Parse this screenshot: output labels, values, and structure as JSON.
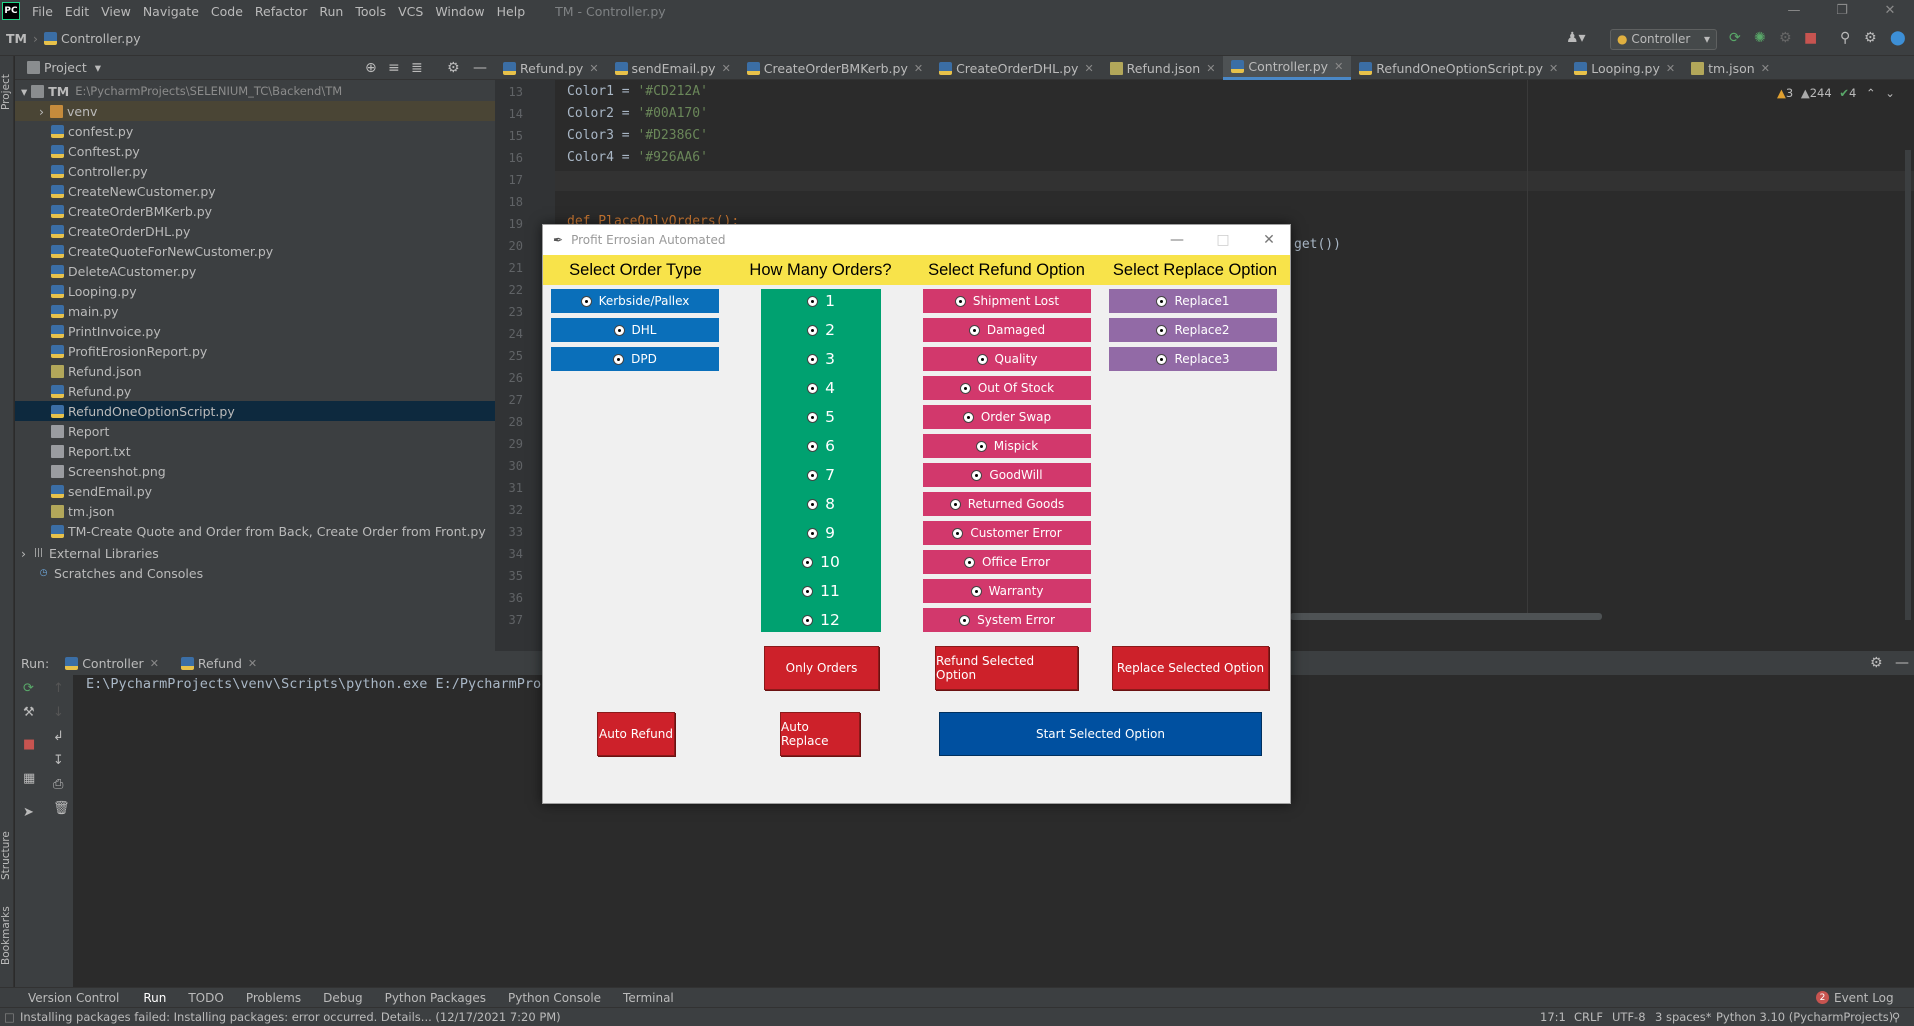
{
  "menubar": {
    "logo": "PC",
    "items": [
      "File",
      "Edit",
      "View",
      "Navigate",
      "Code",
      "Refactor",
      "Run",
      "Tools",
      "VCS",
      "Window",
      "Help"
    ],
    "window_title": "TM - Controller.py"
  },
  "navbar": {
    "project": "TM",
    "file": "Controller.py",
    "run_config": "Controller"
  },
  "sidebar": {
    "project_label": "Project",
    "structure_label": "Structure",
    "bookmarks_label": "Bookmarks"
  },
  "project_tree": {
    "header": "Project",
    "root_name": "TM",
    "root_path": "E:\\PycharmProjects\\SELENIUM_TC\\Backend\\TM",
    "venv": "venv",
    "files": [
      "confest.py",
      "Conftest.py",
      "Controller.py",
      "CreateNewCustomer.py",
      "CreateOrderBMKerb.py",
      "CreateOrderDHL.py",
      "CreateQuoteForNewCustomer.py",
      "DeleteACustomer.py",
      "Looping.py",
      "main.py",
      "PrintInvoice.py",
      "ProfitErosionReport.py",
      "Refund.json",
      "Refund.py",
      "RefundOneOptionScript.py",
      "Report",
      "Report.txt",
      "Screenshot.png",
      "sendEmail.py",
      "tm.json",
      "TM-Create Quote and Order from Back, Create Order from Front.py"
    ],
    "external_libraries": "External Libraries",
    "scratches": "Scratches and Consoles"
  },
  "editor_tabs": [
    "Refund.py",
    "sendEmail.py",
    "CreateOrderBMKerb.py",
    "CreateOrderDHL.py",
    "Refund.json",
    "Controller.py",
    "RefundOneOptionScript.py",
    "Looping.py",
    "tm.json"
  ],
  "inspections": {
    "warnings": "3",
    "weak": "244",
    "ok": "4"
  },
  "editor": {
    "line_numbers": [
      "13",
      "14",
      "15",
      "16",
      "17",
      "18",
      "19",
      "20",
      "21",
      "22",
      "23",
      "24",
      "25",
      "26",
      "27",
      "28",
      "29",
      "30",
      "31",
      "32",
      "33",
      "34",
      "35",
      "36",
      "37"
    ],
    "lines": [
      {
        "var": "Color1",
        "eq": " = ",
        "str": "'#CD212A'"
      },
      {
        "var": "Color2",
        "eq": " = ",
        "str": "'#00A170'"
      },
      {
        "var": "Color3",
        "eq": " = ",
        "str": "'#D2386C'"
      },
      {
        "var": "Color4",
        "eq": " = ",
        "str": "'#926AA6'"
      }
    ],
    "fragment_def": "def PlaceOnlyOrders():",
    "fragment_get": "get())"
  },
  "run_panel": {
    "label": "Run:",
    "tabs": [
      "Controller",
      "Refund"
    ],
    "console_line": "E:\\PycharmProjects\\venv\\Scripts\\python.exe E:/PycharmProj"
  },
  "bottom_tools": [
    "Version Control",
    "Run",
    "TODO",
    "Problems",
    "Debug",
    "Python Packages",
    "Python Console",
    "Terminal"
  ],
  "event_log": {
    "count": "2",
    "label": "Event Log"
  },
  "status": {
    "message": "Installing packages failed: Installing packages: error occurred. Details... (12/17/2021 7:20 PM)",
    "position": "17:1",
    "line_sep": "CRLF",
    "encoding": "UTF-8",
    "indent": "3 spaces*",
    "interpreter": "Python 3.10 (PycharmProjects)"
  },
  "dialog": {
    "title": "Profit Errosian Automated",
    "colors": {
      "header": "#F8E34A",
      "blue": "#0A6FBA",
      "green": "#00A170",
      "pink": "#D2386C",
      "purple": "#926AA6",
      "red": "#CD212A"
    },
    "headers": {
      "order_type": "Select Order Type",
      "how_many": "How Many Orders?",
      "refund": "Select Refund Option",
      "replace": "Select Replace Option"
    },
    "order_types": [
      "Kerbside/Pallex",
      "DHL",
      "DPD"
    ],
    "order_counts": [
      "1",
      "2",
      "3",
      "4",
      "5",
      "6",
      "7",
      "8",
      "9",
      "10",
      "11",
      "12"
    ],
    "refund_options": [
      "Shipment Lost",
      "Damaged",
      "Quality",
      "Out Of Stock",
      "Order Swap",
      "Mispick",
      "GoodWill",
      "Returned Goods",
      "Customer Error",
      "Office Error",
      "Warranty",
      "System Error"
    ],
    "replace_options": [
      "Replace1",
      "Replace2",
      "Replace3"
    ],
    "buttons": {
      "only_orders": "Only Orders",
      "refund_selected": "Refund Selected Option",
      "replace_selected": "Replace Selected Option",
      "auto_refund": "Auto Refund",
      "auto_replace": "Auto Replace",
      "start_selected": "Start Selected Option"
    }
  }
}
